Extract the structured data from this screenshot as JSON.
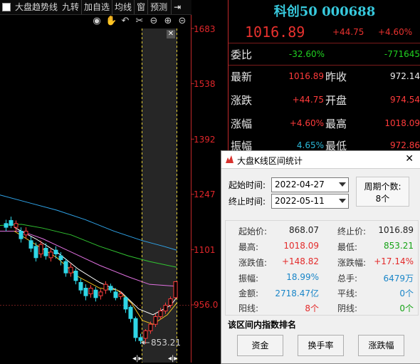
{
  "top_menu": {
    "trend_label": "大盘趋势线",
    "nine_turn": "九转",
    "add_watch": "加自选",
    "ma_line": "均线",
    "window": "窗",
    "alert": "预测"
  },
  "price_axis": [
    "1683",
    "1538",
    "1392",
    "1247",
    "1101",
    "956.0"
  ],
  "low_marker": "853.21",
  "quote": {
    "title": "科创50 000688",
    "price": "1016.89",
    "change": "+44.75",
    "change_pct": "+4.60%",
    "rows": [
      {
        "label": "委比",
        "value": "-32.60%",
        "value_color": "green",
        "label2": "",
        "value2": "-771645",
        "value2_color": "green"
      },
      {
        "label": "最新",
        "value": "1016.89",
        "value_color": "red",
        "label2": "昨收",
        "value2": "972.14",
        "value2_color": "white"
      },
      {
        "label": "涨跌",
        "value": "+44.75",
        "value_color": "red",
        "label2": "开盘",
        "value2": "974.54",
        "value2_color": "red"
      },
      {
        "label": "涨幅",
        "value": "+4.60%",
        "value_color": "red",
        "label2": "最高",
        "value2": "1018.09",
        "value2_color": "red"
      },
      {
        "label": "振幅",
        "value": "4.65%",
        "value_color": "cyan",
        "label2": "最低",
        "value2": "972.86",
        "value2_color": "red"
      }
    ]
  },
  "dialog": {
    "title": "大盘K线区间统计",
    "start_label": "起始时间:",
    "start_value": "2022-04-27",
    "end_label": "终止时间:",
    "end_value": "2022-05-11",
    "period_label": "周期个数:",
    "period_value": "8个",
    "stats": [
      {
        "l": "起始价:",
        "v": "868.07",
        "c": "sk",
        "l2": "终止价:",
        "v2": "1016.89",
        "c2": "sk"
      },
      {
        "l": "最高:",
        "v": "1018.09",
        "c": "sr",
        "l2": "最低:",
        "v2": "853.21",
        "c2": "sg"
      },
      {
        "l": "涨跌值:",
        "v": "+148.82",
        "c": "sr",
        "l2": "涨跌幅:",
        "v2": "+17.14%",
        "c2": "sr"
      },
      {
        "l": "振幅:",
        "v": "18.99%",
        "c": "sb",
        "l2": "总手:",
        "v2": "6479万",
        "c2": "sb"
      },
      {
        "l": "金额:",
        "v": "2718.47亿",
        "c": "sb",
        "l2": "平线:",
        "v2": "0个",
        "c2": "sb"
      },
      {
        "l": "阳线:",
        "v": "8个",
        "c": "sr",
        "l2": "阴线:",
        "v2": "0个",
        "c2": "sg"
      }
    ],
    "rank_title": "该区间内指数排名",
    "buttons": [
      "资金",
      "换手率",
      "涨跌幅"
    ]
  }
}
